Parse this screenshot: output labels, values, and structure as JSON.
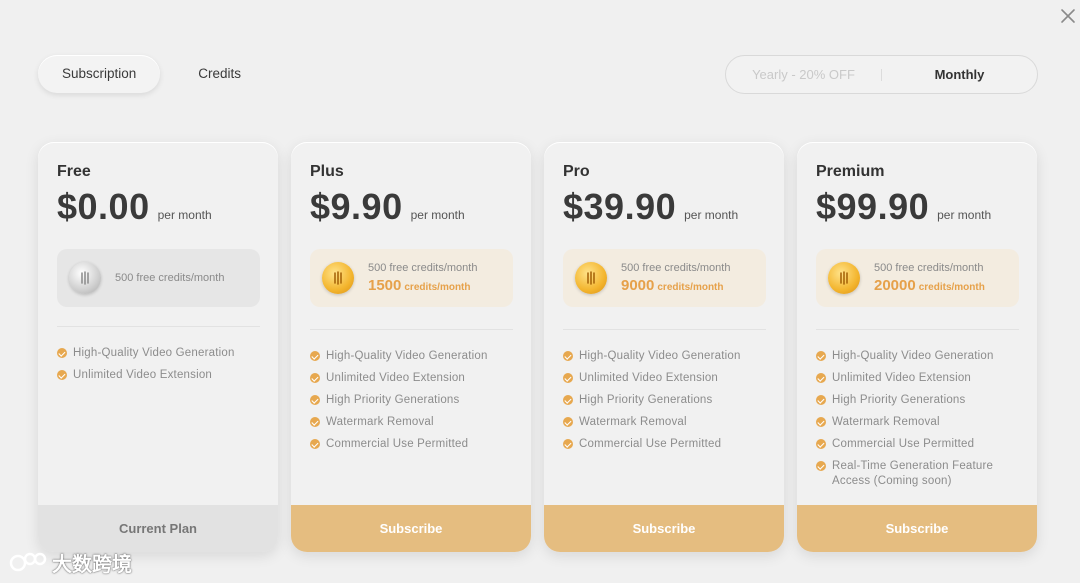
{
  "tabs": [
    {
      "label": "Subscription",
      "active": true
    },
    {
      "label": "Credits",
      "active": false
    }
  ],
  "billing": {
    "yearly_label": "Yearly - 20% OFF",
    "monthly_label": "Monthly",
    "selected": "Monthly"
  },
  "plans": [
    {
      "name": "Free",
      "price": "$0.00",
      "per": "per month",
      "credits_line1": "500 free credits/month",
      "credits_amount": "",
      "credits_unit": "",
      "features": [
        "High-Quality Video Generation",
        "Unlimited Video Extension"
      ],
      "cta": "Current Plan"
    },
    {
      "name": "Plus",
      "price": "$9.90",
      "per": "per month",
      "credits_line1": "500 free credits/month",
      "credits_amount": "1500",
      "credits_unit": "credits/month",
      "features": [
        "High-Quality Video Generation",
        "Unlimited Video Extension",
        "High Priority Generations",
        "Watermark Removal",
        "Commercial Use Permitted"
      ],
      "cta": "Subscribe"
    },
    {
      "name": "Pro",
      "price": "$39.90",
      "per": "per month",
      "credits_line1": "500 free credits/month",
      "credits_amount": "9000",
      "credits_unit": "credits/month",
      "features": [
        "High-Quality Video Generation",
        "Unlimited Video Extension",
        "High Priority Generations",
        "Watermark Removal",
        "Commercial Use Permitted"
      ],
      "cta": "Subscribe"
    },
    {
      "name": "Premium",
      "price": "$99.90",
      "per": "per month",
      "credits_line1": "500 free credits/month",
      "credits_amount": "20000",
      "credits_unit": "credits/month",
      "features": [
        "High-Quality Video Generation",
        "Unlimited Video Extension",
        "High Priority Generations",
        "Watermark Removal",
        "Commercial Use Permitted",
        "Real-Time Generation Feature Access (Coming soon)"
      ],
      "cta": "Subscribe"
    }
  ],
  "watermark": "大数跨境",
  "colors": {
    "accent": "#e5bd80",
    "check": "#e7a84f",
    "credits_text": "#e6a14a",
    "background": "#f0f0f0"
  },
  "icons": {
    "close": "close-icon",
    "coin": "coin-icon",
    "check": "check-icon"
  }
}
